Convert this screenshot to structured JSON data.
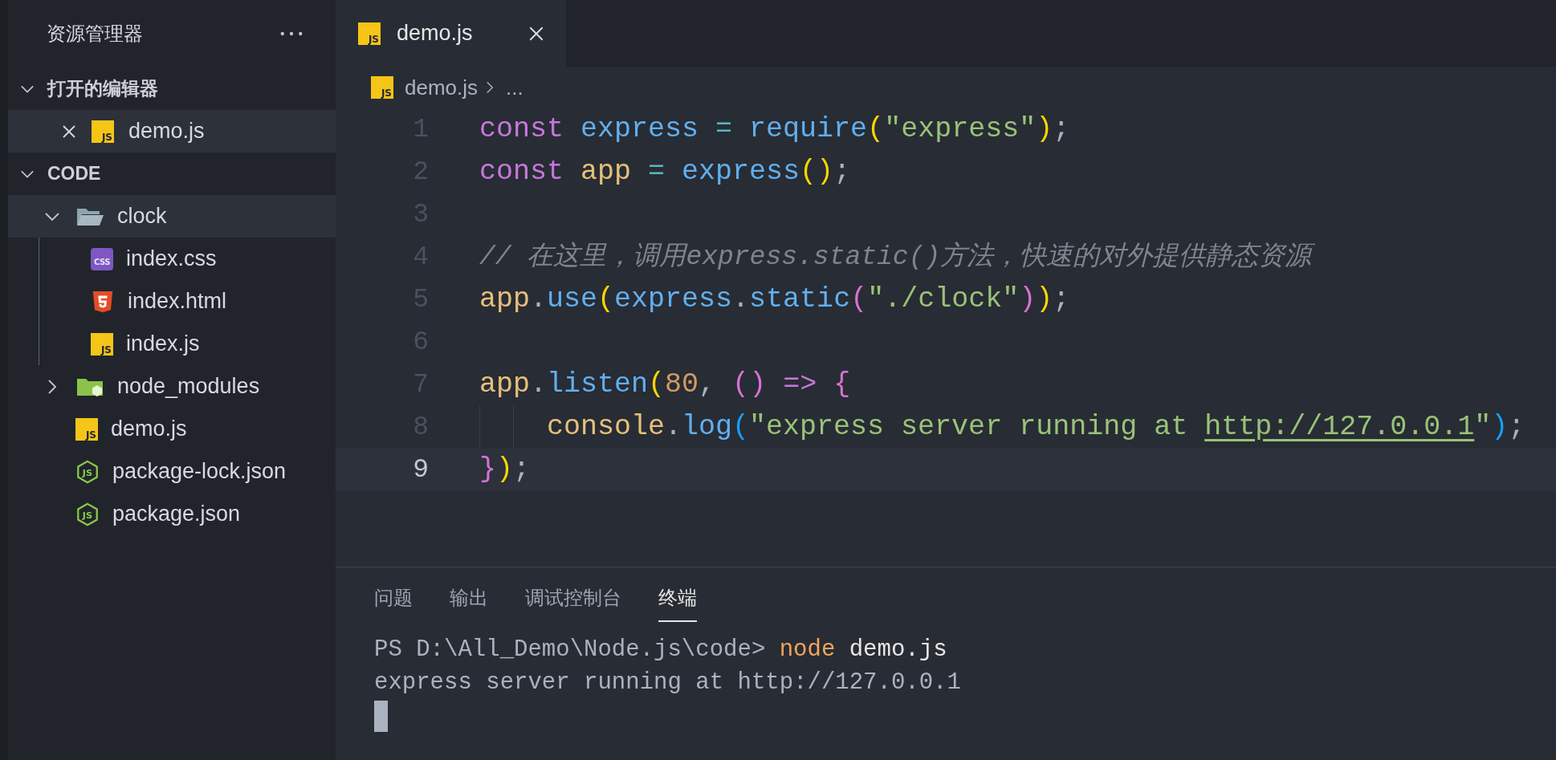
{
  "sidebar": {
    "title": "资源管理器",
    "sections": [
      {
        "title": "打开的编辑器",
        "expanded": true,
        "kind": "open-editors",
        "items": [
          {
            "label": "demo.js",
            "kind": "js",
            "icon_label": "JS",
            "selected": true
          }
        ]
      },
      {
        "title": "CODE",
        "expanded": true,
        "kind": "tree",
        "items": [
          {
            "label": "clock",
            "kind": "folder",
            "expanded": true,
            "selected": true,
            "children": [
              {
                "label": "index.css",
                "kind": "css",
                "icon_label": "CSS",
                "selected": false
              },
              {
                "label": "index.html",
                "kind": "html",
                "selected": false
              },
              {
                "label": "index.js",
                "kind": "js",
                "icon_label": "JS",
                "selected": false
              }
            ]
          },
          {
            "label": "node_modules",
            "kind": "node-folder",
            "expanded": false,
            "selected": false
          },
          {
            "label": "demo.js",
            "kind": "js",
            "icon_label": "JS",
            "selected": false
          },
          {
            "label": "package-lock.json",
            "kind": "node-json",
            "icon_label": "JS",
            "selected": false
          },
          {
            "label": "package.json",
            "kind": "node-json",
            "icon_label": "JS",
            "selected": false
          }
        ]
      }
    ]
  },
  "editor": {
    "tabs": [
      {
        "label": "demo.js",
        "kind": "js",
        "icon_label": "JS",
        "selected": true
      }
    ],
    "breadcrumb": [
      {
        "label": "demo.js",
        "kind": "js",
        "icon_label": "JS"
      },
      {
        "label": "...",
        "kind": "more"
      }
    ],
    "lines": [
      {
        "number": "1",
        "current": false,
        "indent_guide": false,
        "tokens": [
          {
            "text": "const ",
            "kind": "keyword"
          },
          {
            "text": "express ",
            "kind": "function"
          },
          {
            "text": "= ",
            "kind": "operator"
          },
          {
            "text": "require",
            "kind": "function"
          },
          {
            "text": "(",
            "kind": "bracket1"
          },
          {
            "text": "\"express\"",
            "kind": "string"
          },
          {
            "text": ")",
            "kind": "bracket1"
          },
          {
            "text": ";",
            "kind": "punct"
          }
        ]
      },
      {
        "number": "2",
        "current": false,
        "indent_guide": false,
        "tokens": [
          {
            "text": "const ",
            "kind": "keyword"
          },
          {
            "text": "app ",
            "kind": "variable"
          },
          {
            "text": "= ",
            "kind": "operator"
          },
          {
            "text": "express",
            "kind": "function"
          },
          {
            "text": "(",
            "kind": "bracket1"
          },
          {
            "text": ")",
            "kind": "bracket1"
          },
          {
            "text": ";",
            "kind": "punct"
          }
        ]
      },
      {
        "number": "3",
        "current": false,
        "indent_guide": false
      },
      {
        "number": "4",
        "current": false,
        "indent_guide": false,
        "tokens": [
          {
            "text": "// 在这里，调用express.static()方法，快速的对外提供静态资源",
            "kind": "comment"
          }
        ]
      },
      {
        "number": "5",
        "current": false,
        "indent_guide": false,
        "tokens": [
          {
            "text": "app",
            "kind": "variable"
          },
          {
            "text": ".",
            "kind": "punct"
          },
          {
            "text": "use",
            "kind": "function"
          },
          {
            "text": "(",
            "kind": "bracket1"
          },
          {
            "text": "express",
            "kind": "function"
          },
          {
            "text": ".",
            "kind": "punct"
          },
          {
            "text": "static",
            "kind": "function"
          },
          {
            "text": "(",
            "kind": "bracket2"
          },
          {
            "text": "\"./clock\"",
            "kind": "string"
          },
          {
            "text": ")",
            "kind": "bracket2"
          },
          {
            "text": ")",
            "kind": "bracket1"
          },
          {
            "text": ";",
            "kind": "punct"
          }
        ]
      },
      {
        "number": "6",
        "current": false,
        "indent_guide": false
      },
      {
        "number": "7",
        "current": false,
        "indent_guide": false,
        "tokens": [
          {
            "text": "app",
            "kind": "variable"
          },
          {
            "text": ".",
            "kind": "punct"
          },
          {
            "text": "listen",
            "kind": "function"
          },
          {
            "text": "(",
            "kind": "bracket1"
          },
          {
            "text": "80",
            "kind": "number"
          },
          {
            "text": ", ",
            "kind": "punct"
          },
          {
            "text": "(",
            "kind": "bracket2"
          },
          {
            "text": ") ",
            "kind": "bracket2"
          },
          {
            "text": "=> ",
            "kind": "keyword"
          },
          {
            "text": "{",
            "kind": "bracket2"
          }
        ]
      },
      {
        "number": "8",
        "current": false,
        "indent_guide": true,
        "tokens": [
          {
            "text": "console",
            "kind": "variable"
          },
          {
            "text": ".",
            "kind": "punct"
          },
          {
            "text": "log",
            "kind": "function"
          },
          {
            "text": "(",
            "kind": "bracket3"
          },
          {
            "text": "\"express server running at ",
            "kind": "string"
          },
          {
            "text": "http://127.0.0.1",
            "kind": "link"
          },
          {
            "text": "\"",
            "kind": "string"
          },
          {
            "text": ")",
            "kind": "bracket3"
          },
          {
            "text": ";",
            "kind": "punct"
          }
        ]
      },
      {
        "number": "9",
        "current": true,
        "indent_guide": false,
        "tokens": [
          {
            "text": "}",
            "kind": "bracket2"
          },
          {
            "text": ")",
            "kind": "bracket1"
          },
          {
            "text": ";",
            "kind": "punct"
          }
        ]
      }
    ]
  },
  "panel": {
    "tabs": [
      {
        "label": "问题",
        "selected": false
      },
      {
        "label": "输出",
        "selected": false
      },
      {
        "label": "调试控制台",
        "selected": false
      },
      {
        "label": "终端",
        "selected": true
      }
    ],
    "terminal": [
      {
        "tokens": [
          {
            "text": "PS D:\\All_Demo\\Node.js\\code> ",
            "kind": "prompt"
          },
          {
            "text": "node",
            "kind": "command"
          },
          {
            "text": " demo.js",
            "kind": "argument"
          }
        ]
      },
      {
        "tokens": [
          {
            "text": "express server running at http://127.0.0.1",
            "kind": "output"
          }
        ]
      }
    ]
  }
}
